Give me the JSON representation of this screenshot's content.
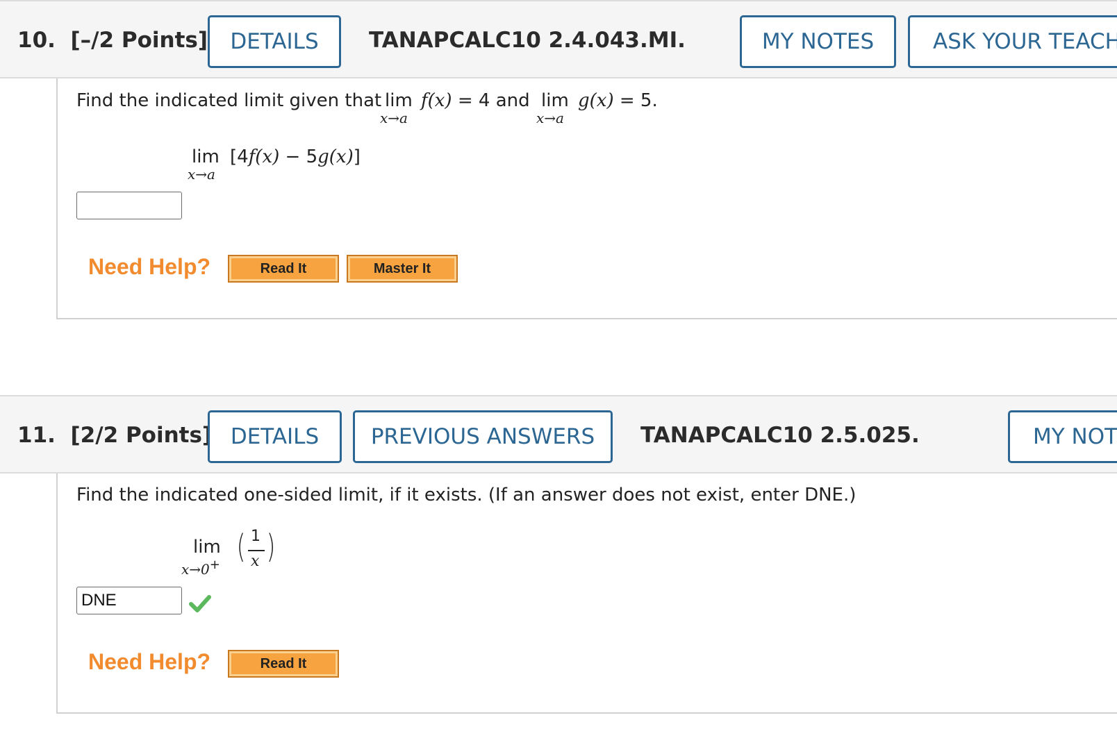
{
  "q10": {
    "number": "10.",
    "points": "[–/2 Points]",
    "details_label": "DETAILS",
    "code": "TANAPCALC10 2.4.043.MI.",
    "my_notes_label": "MY NOTES",
    "ask_teacher_label": "ASK YOUR TEACHER",
    "prompt_intro": "Find the indicated limit given that",
    "lim": "lim",
    "sub_x_to_a": "x→a",
    "f_of_x": "f(x)",
    "eq_4_and": " = 4 and",
    "g_of_x": "g(x)",
    "eq_5": " = 5.",
    "expr_open": "[4",
    "expr_f": "f(x)",
    "expr_minus": " − 5",
    "expr_g": "g(x)",
    "expr_close": "]",
    "answer_value": "",
    "need_help": "Need Help?",
    "read_it": "Read It",
    "master_it": "Master It"
  },
  "q11": {
    "number": "11.",
    "points": "[2/2 Points]",
    "details_label": "DETAILS",
    "previous_answers_label": "PREVIOUS ANSWERS",
    "code": "TANAPCALC10 2.5.025.",
    "my_notes_label": "MY NOTES",
    "prompt": "Find the indicated one-sided limit, if it exists. (If an answer does not exist, enter DNE.)",
    "lim": "lim",
    "sub_x_to_0": "x→0",
    "sup_plus": "+",
    "numerator": "1",
    "denominator": "x",
    "answer_value": "DNE",
    "need_help": "Need Help?",
    "read_it": "Read It"
  },
  "colors": {
    "accent": "#2c6693",
    "help_orange": "#f28a2e",
    "button_orange": "#f7a33f",
    "check_green": "#5cb85c"
  },
  "icons": {
    "correct": "checkmark-icon"
  }
}
